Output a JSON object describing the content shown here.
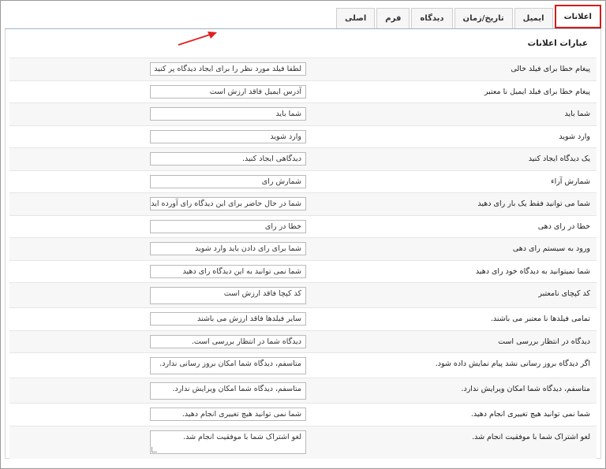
{
  "tabs": [
    {
      "label": "اعلانات",
      "active": true
    },
    {
      "label": "ایمیل",
      "active": false
    },
    {
      "label": "تاریخ/زمان",
      "active": false
    },
    {
      "label": "دیدگاه",
      "active": false
    },
    {
      "label": "فرم",
      "active": false
    },
    {
      "label": "اصلی",
      "active": false
    }
  ],
  "section_title": "عبارات اعلانات",
  "rows": [
    {
      "label": "پیغام خطا برای فیلد خالی",
      "value": "لطفا فیلد مورد نظر را برای ایجاد دیدگاه پر کنید"
    },
    {
      "label": "پیغام خطا برای فیلد ایمیل نا معتبر",
      "value": "آدرس ایمیل فاقد ارزش است"
    },
    {
      "label": "شما باید",
      "value": "شما باید"
    },
    {
      "label": "وارد شوید",
      "value": "وارد شوید"
    },
    {
      "label": "یک دیدگاه ایجاد کنید",
      "value": "دیدگاهی ایجاد کنید."
    },
    {
      "label": "شمارش آراء",
      "value": "شمارش رای"
    },
    {
      "label": "شما می توانید فقط یک بار رای دهید",
      "value": "شما در حال حاضر برای این دیدگاه رای آورده اید"
    },
    {
      "label": "خطا در رای دهی",
      "value": "خطا در رای"
    },
    {
      "label": "ورود به سیستم رای دهی",
      "value": "شما برای رای دادن باید وارد شوید"
    },
    {
      "label": "شما نمیتوانید به دیدگاه خود رای دهید",
      "value": "شما نمی توانید به این دیدگاه رای دهید"
    },
    {
      "label": "کد کپچای نامعتبر",
      "value": "کد کپچا فاقد ارزش است"
    },
    {
      "label": "تمامی فیلدها نا معتبر می باشند.",
      "value": "سایر فیلدها فاقد ارزش می باشند"
    },
    {
      "label": "دیدگاه در انتظار بررسی است",
      "value": "دیدگاه شما در انتظار بررسی است."
    },
    {
      "label": "اگر دیدگاه بروز رسانی نشد پیام نمایش داده شود.",
      "value": "متاسفم، دیدگاه شما امکان بروز رسانی ندارد."
    },
    {
      "label": "متاسفم، دیدگاه شما امکان ویرایش ندارد.",
      "value": "متاسفم، دیدگاه شما امکان ویرایش ندارد."
    },
    {
      "label": "شما نمی توانید هیچ تغییری انجام دهید.",
      "value": "شما نمی توانید هیچ تغییری انجام دهید."
    },
    {
      "label": "لغو اشتراک شما با موفقیت انجام شد.",
      "value": "لغو اشتراک شما با موفقیت انجام شد."
    }
  ],
  "colors": {
    "highlight": "#d31c1c",
    "arrow": "#e02020"
  }
}
